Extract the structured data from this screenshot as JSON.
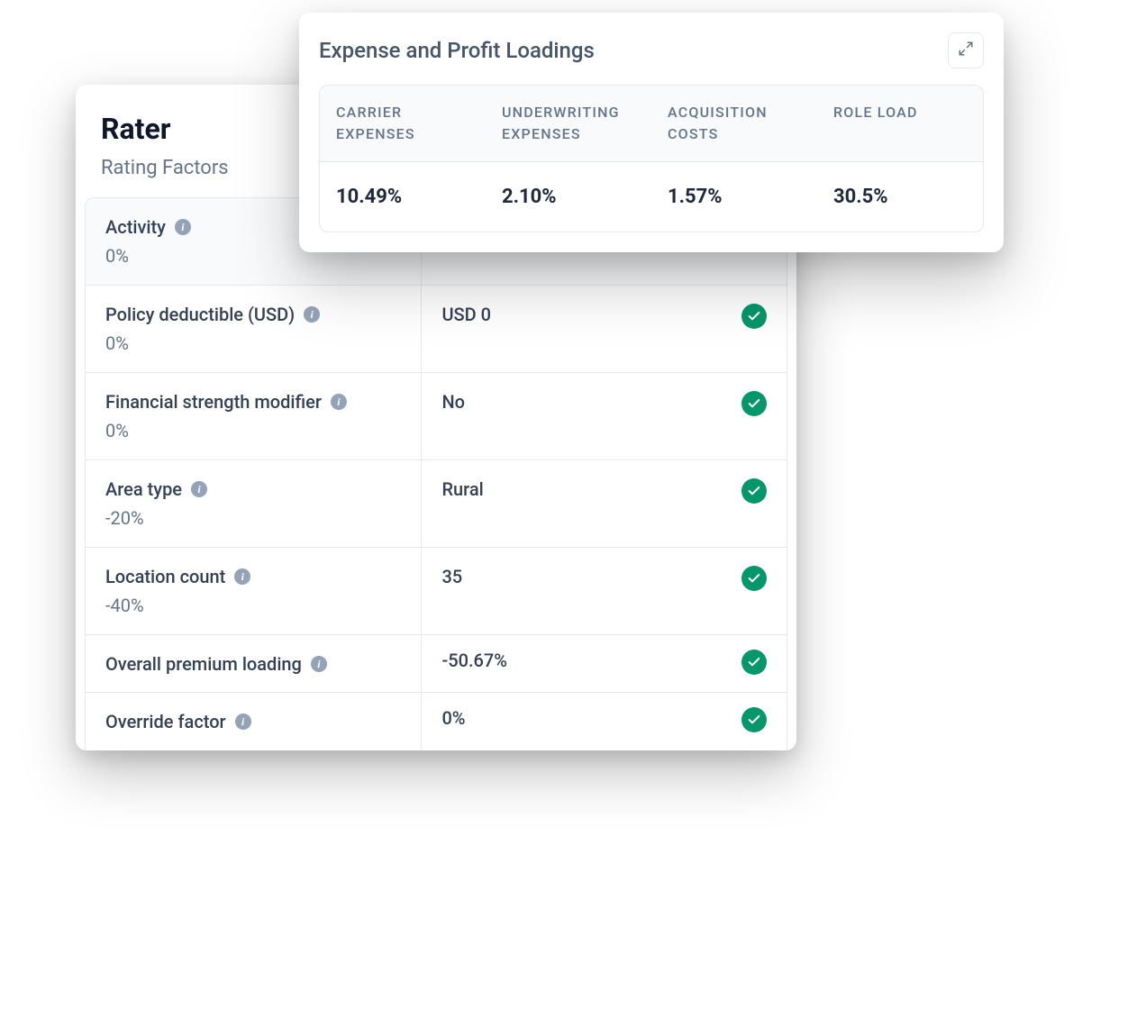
{
  "rater": {
    "title": "Rater",
    "subtitle": "Rating Factors",
    "factors": [
      {
        "label": "Activity",
        "pct": "0%",
        "value": "",
        "has_info": true,
        "has_check": false,
        "is_header": true
      },
      {
        "label": "Policy deductible (USD)",
        "pct": "0%",
        "value": "USD 0",
        "has_info": true,
        "has_check": true,
        "is_header": false
      },
      {
        "label": "Financial strength modifier",
        "pct": "0%",
        "value": "No",
        "has_info": true,
        "has_check": true,
        "is_header": false
      },
      {
        "label": "Area type",
        "pct": "-20%",
        "value": "Rural",
        "has_info": true,
        "has_check": true,
        "is_header": false
      },
      {
        "label": "Location count",
        "pct": "-40%",
        "value": "35",
        "has_info": true,
        "has_check": true,
        "is_header": false
      },
      {
        "label": "Overall premium loading",
        "pct": "",
        "value": "-50.67%",
        "has_info": true,
        "has_check": true,
        "is_header": false,
        "compact": true
      },
      {
        "label": "Override factor",
        "pct": "",
        "value": "0%",
        "has_info": true,
        "has_check": true,
        "is_header": false,
        "compact": true
      }
    ]
  },
  "loadings": {
    "title": "Expense and Profit Loadings",
    "columns": [
      "CARRIER EXPENSES",
      "UNDERWRITING EXPENSES",
      "ACQUISITION COSTS",
      "ROLE LOAD"
    ],
    "values": [
      "10.49%",
      "2.10%",
      "1.57%",
      "30.5%"
    ]
  }
}
